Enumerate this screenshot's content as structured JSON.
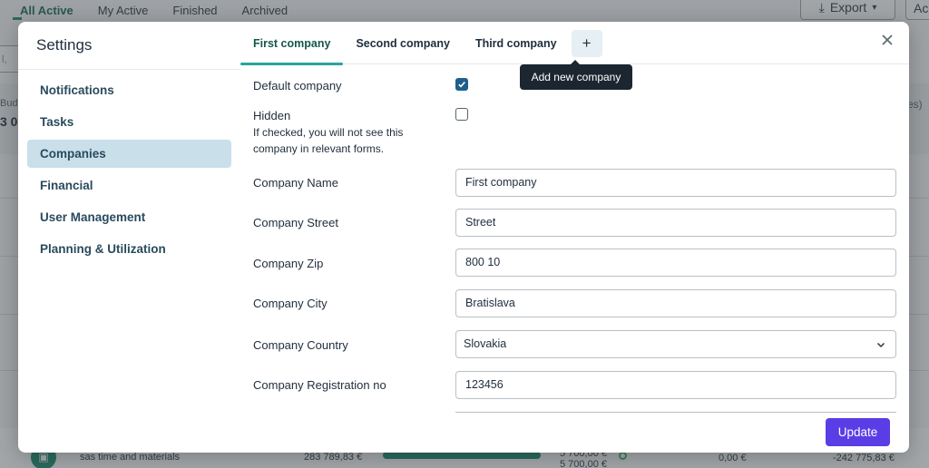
{
  "background": {
    "tabs": [
      "All Active",
      "My Active",
      "Finished",
      "Archived"
    ],
    "export_label": "Export",
    "ac_label": "Ac",
    "search_partial": "l, cc",
    "budget_label": "Bud",
    "budget_value": "3 0",
    "es_label": "es)",
    "row": {
      "description": "sas time and materials",
      "amount": "283 789,83 €",
      "value_top": "5 700,00 €",
      "value_bottom": "5 700,00 €",
      "zero": "0,00 €",
      "balance": "-242 775,83 €"
    }
  },
  "modal": {
    "title": "Settings",
    "sidebar": {
      "items": [
        {
          "label": "Notifications",
          "active": false
        },
        {
          "label": "Tasks",
          "active": false
        },
        {
          "label": "Companies",
          "active": true
        },
        {
          "label": "Financial",
          "active": false
        },
        {
          "label": "User Management",
          "active": false
        },
        {
          "label": "Planning & Utilization",
          "active": false
        }
      ]
    },
    "tabs": [
      {
        "label": "First company",
        "active": true
      },
      {
        "label": "Second company",
        "active": false
      },
      {
        "label": "Third company",
        "active": false
      }
    ],
    "add_tab_symbol": "+",
    "tooltip": "Add new company",
    "form": {
      "default_company_label": "Default company",
      "default_company_checked": true,
      "hidden_label": "Hidden",
      "hidden_help": "If checked, you will not see this company in relevant forms.",
      "hidden_checked": false,
      "company_name_label": "Company Name",
      "company_name_value": "First company",
      "company_street_label": "Company Street",
      "company_street_value": "Street",
      "company_zip_label": "Company Zip",
      "company_zip_value": "800 10",
      "company_city_label": "Company City",
      "company_city_value": "Bratislava",
      "company_country_label": "Company Country",
      "company_country_value": "Slovakia",
      "company_registration_label": "Company Registration no",
      "company_registration_value": "123456"
    },
    "update_label": "Update"
  },
  "colors": {
    "accent_primary": "#5b3de6",
    "tab_underline": "#2aa59a",
    "sidebar_active_bg": "#c9e0ea",
    "checkbox_checked": "#1f5f8b"
  }
}
